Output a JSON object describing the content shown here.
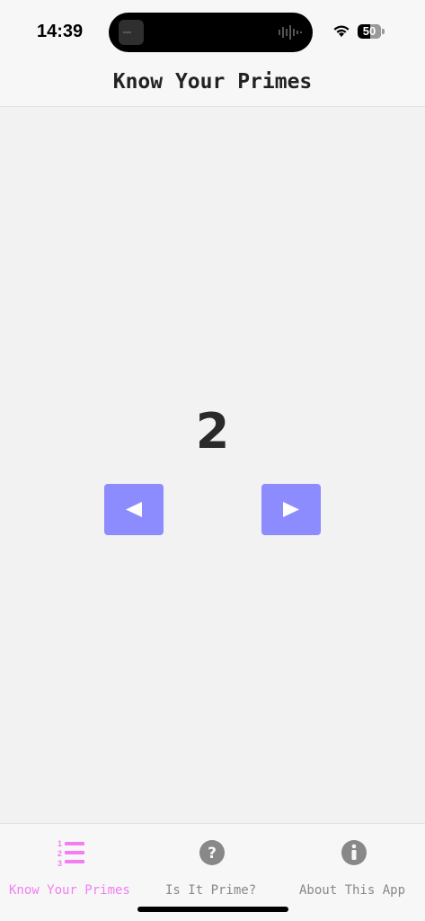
{
  "status_bar": {
    "time": "14:39",
    "battery": "50",
    "battery_level_percent": 50
  },
  "header": {
    "title": "Know Your Primes"
  },
  "main": {
    "current_number": "2",
    "prev_button_icon": "left-triangle-icon",
    "next_button_icon": "right-triangle-icon",
    "button_color": "#8c8cff"
  },
  "tab_bar": {
    "active_color": "#f27ef2",
    "inactive_color": "#888888",
    "tabs": [
      {
        "label": "Know Your Primes",
        "icon": "numbered-list-icon",
        "active": true
      },
      {
        "label": "Is It Prime?",
        "icon": "question-circle-icon",
        "active": false
      },
      {
        "label": "About This App",
        "icon": "info-circle-icon",
        "active": false
      }
    ]
  }
}
